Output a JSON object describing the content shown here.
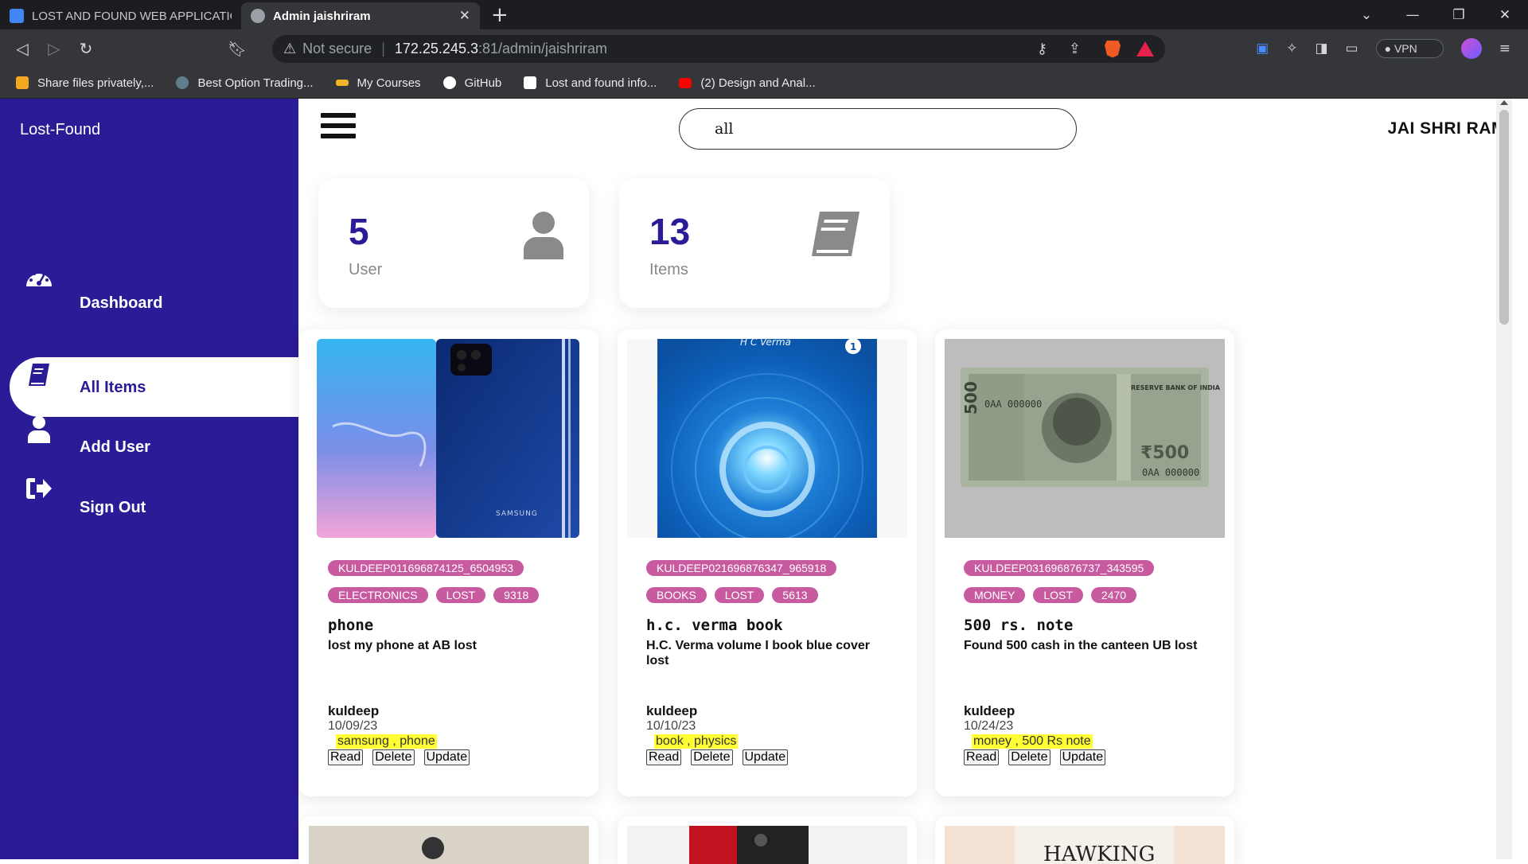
{
  "browser": {
    "tabs": [
      {
        "title": "LOST AND FOUND WEB APPLICATION",
        "favicon_color": "#4285f4"
      },
      {
        "title": "Admin jaishriram",
        "favicon_color": "#9aa0a6",
        "active": true
      }
    ],
    "address": {
      "security": "Not secure",
      "host": "172.25.245.3",
      "path": ":81/admin/jaishriram"
    },
    "vpn_label": "VPN",
    "bookmarks": [
      {
        "label": "Share files privately,...",
        "color": "#f5a623"
      },
      {
        "label": "Best Option Trading...",
        "color": "#607d8b"
      },
      {
        "label": "My Courses",
        "color": "#f0b429"
      },
      {
        "label": "GitHub",
        "color": "#ffffff"
      },
      {
        "label": "Lost and found info...",
        "color": "#ffffff"
      },
      {
        "label": "(2) Design and Anal...",
        "color": "#ff0000"
      }
    ]
  },
  "app": {
    "brand": "Lost-Found",
    "nav": [
      {
        "label": "Dashboard",
        "icon": "gauge-icon"
      },
      {
        "label": "All Items",
        "icon": "book-icon",
        "active": true
      },
      {
        "label": "Add User",
        "icon": "user-icon"
      },
      {
        "label": "Sign Out",
        "icon": "sign-out-icon"
      }
    ],
    "search": {
      "value": "all"
    },
    "username": "JAI SHRI RAM",
    "stats": [
      {
        "value": "5",
        "label": "User",
        "icon": "user-icon"
      },
      {
        "value": "13",
        "label": "Items",
        "icon": "book-icon"
      }
    ],
    "items": [
      {
        "id": "KULDEEP011696874125_6504953",
        "category": "ELECTRONICS",
        "status": "LOST",
        "code": "9318",
        "title": "phone",
        "description": "lost my phone at AB lost",
        "owner": "kuldeep",
        "date": "10/09/23",
        "keywords": "samsung , phone"
      },
      {
        "id": "KULDEEP021696876347_965918",
        "category": "BOOKS",
        "status": "LOST",
        "code": "5613",
        "title": "h.c. verma book",
        "description": "H.C. Verma volume I book blue cover lost",
        "owner": "kuldeep",
        "date": "10/10/23",
        "keywords": "book , physics"
      },
      {
        "id": "KULDEEP031696876737_343595",
        "category": "MONEY",
        "status": "LOST",
        "code": "2470",
        "title": "500 rs. note",
        "description": "Found 500 cash in the canteen UB lost",
        "owner": "kuldeep",
        "date": "10/24/23",
        "keywords": "money , 500 Rs note"
      }
    ],
    "actions": {
      "read": "Read",
      "delete": "Delete",
      "update": "Update"
    },
    "image_text": {
      "book_cover_author": "H C Verma",
      "book_cover_volume": "1",
      "phone_brand": "SAMSUNG",
      "note_bank": "RESERVE BANK OF INDIA",
      "note_value": "₹500",
      "next_book_title": "HAWKING"
    },
    "colors": {
      "sidebar": "#2a1b97",
      "tag": "#c85aa0",
      "highlight": "#ffff33"
    }
  }
}
